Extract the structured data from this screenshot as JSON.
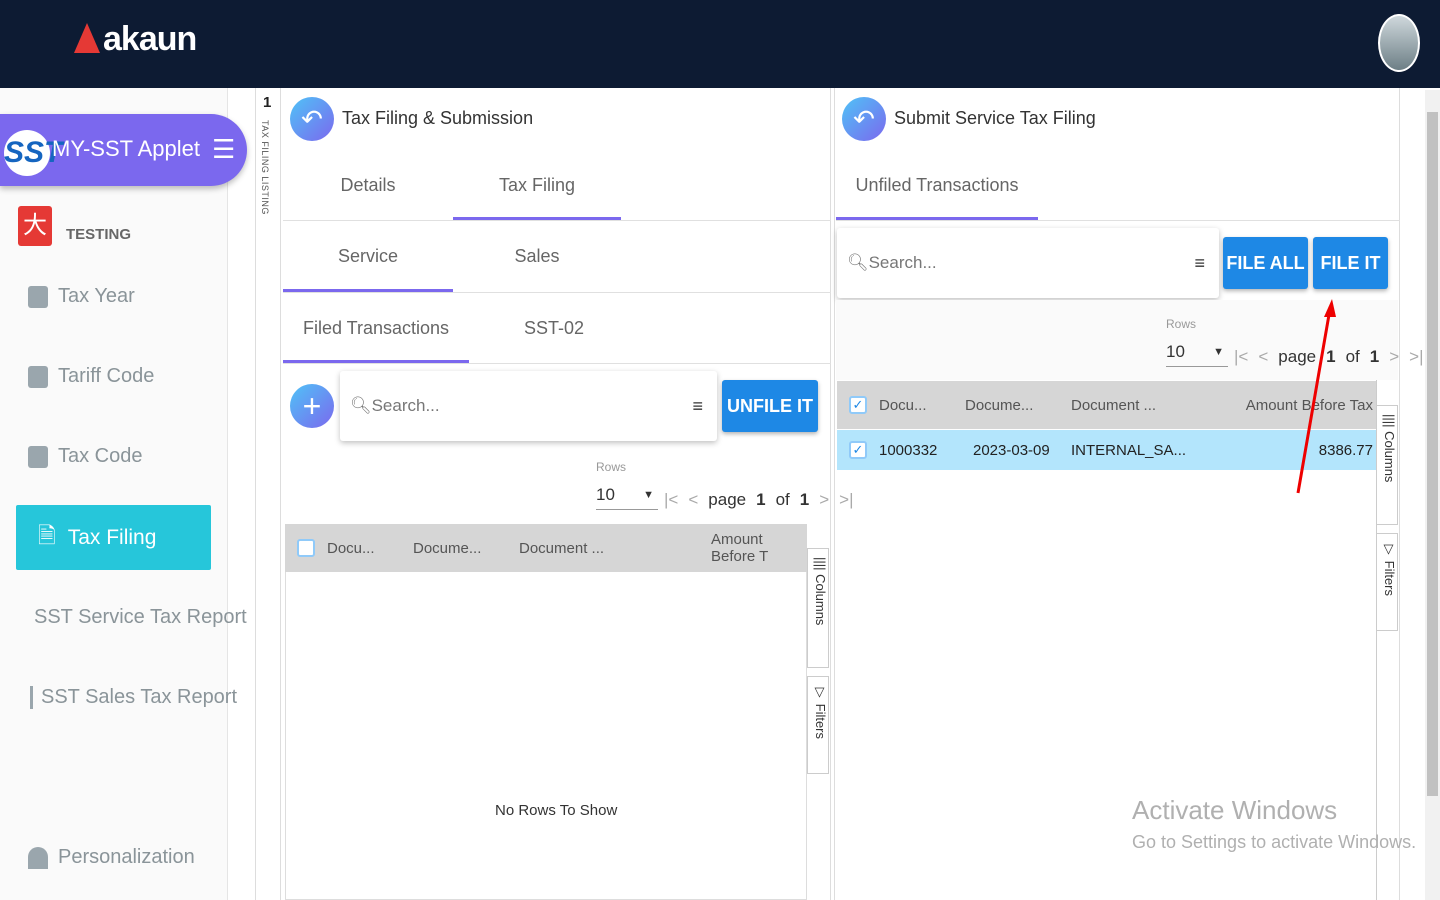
{
  "header": {
    "logo": "akaun"
  },
  "sidebar": {
    "applet": "MY-SST Applet",
    "applet_logo": "SST",
    "company": "TESTING",
    "items": [
      {
        "label": "Tax Year"
      },
      {
        "label": "Tariff Code"
      },
      {
        "label": "Tax Code"
      },
      {
        "label": "Tax Filing"
      },
      {
        "label": "SST Service Tax Report"
      },
      {
        "label": "SST Sales Tax Report"
      },
      {
        "label": "Personalization"
      }
    ]
  },
  "strip": {
    "count": "1",
    "label": "TAX FILING LISTING"
  },
  "left_panel": {
    "title": "Tax Filing & Submission",
    "tabs": [
      "Details",
      "Tax Filing"
    ],
    "subtabs": [
      "Service",
      "Sales"
    ],
    "subtabs2": [
      "Filed Transactions",
      "SST-02"
    ],
    "search_placeholder": "Search...",
    "unfile_button": "UNFILE IT",
    "rows_label": "Rows",
    "rows_value": "10",
    "page_word": "page",
    "page": "1",
    "of_word": "of",
    "total_pages": "1",
    "columns": [
      "Docu...",
      "Docume...",
      "Document ...",
      "Amount Before T"
    ],
    "empty": "No Rows To Show",
    "tool_columns": "Columns",
    "tool_filters": "Filters"
  },
  "right_panel": {
    "title": "Submit Service Tax Filing",
    "tab": "Unfiled Transactions",
    "search_placeholder": "Search...",
    "file_all_button": "FILE ALL",
    "file_it_button": "FILE IT",
    "rows_label": "Rows",
    "rows_value": "10",
    "page_word": "page",
    "page": "1",
    "of_word": "of",
    "total_pages": "1",
    "columns": [
      "Docu...",
      "Docume...",
      "Document ...",
      "Amount Before Tax"
    ],
    "rows": [
      {
        "doc_no": "1000332",
        "date": "2023-03-09",
        "type": "INTERNAL_SA...",
        "amount": "8386.77"
      }
    ],
    "tool_columns": "Columns",
    "tool_filters": "Filters"
  },
  "watermark": {
    "title": "Activate Windows",
    "sub": "Go to Settings to activate Windows."
  },
  "colors": {
    "header": "#0d1b33",
    "accent": "#7b68ee",
    "active": "#26c6da",
    "button": "#1e88e5"
  }
}
